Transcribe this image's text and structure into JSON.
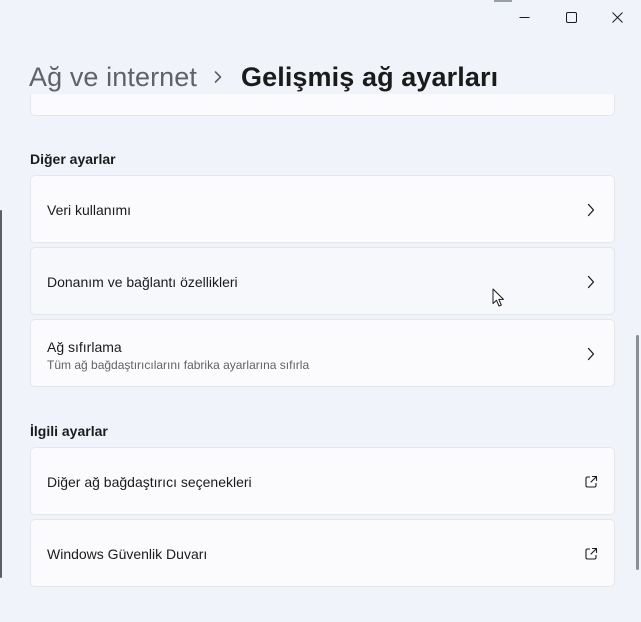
{
  "window": {
    "minimize_icon": "minimize-icon",
    "maximize_icon": "maximize-icon",
    "close_icon": "close-icon"
  },
  "header": {
    "breadcrumb_parent": "Ağ ve internet",
    "breadcrumb_separator_icon": "chevron-right-icon",
    "breadcrumb_current": "Gelişmiş ağ ayarları"
  },
  "sections": {
    "other_settings": {
      "title": "Diğer ayarlar",
      "items": [
        {
          "label": "Veri kullanımı",
          "icon": "chevron-right-icon"
        },
        {
          "label": "Donanım ve bağlantı özellikleri",
          "icon": "chevron-right-icon"
        },
        {
          "label": "Ağ sıfırlama",
          "description": "Tüm ağ bağdaştırıcılarını fabrika ayarlarına sıfırla",
          "icon": "chevron-right-icon"
        }
      ]
    },
    "related_settings": {
      "title": "İlgili ayarlar",
      "items": [
        {
          "label": "Diğer ağ bağdaştırıcı seçenekleri",
          "icon": "external-link-icon"
        },
        {
          "label": "Windows Güvenlik Duvarı",
          "icon": "external-link-icon"
        }
      ]
    }
  },
  "colors": {
    "background": "#f0f3f9",
    "card": "#fbfbfd",
    "text_primary": "#1b1b1b",
    "text_secondary": "#5f6368"
  }
}
